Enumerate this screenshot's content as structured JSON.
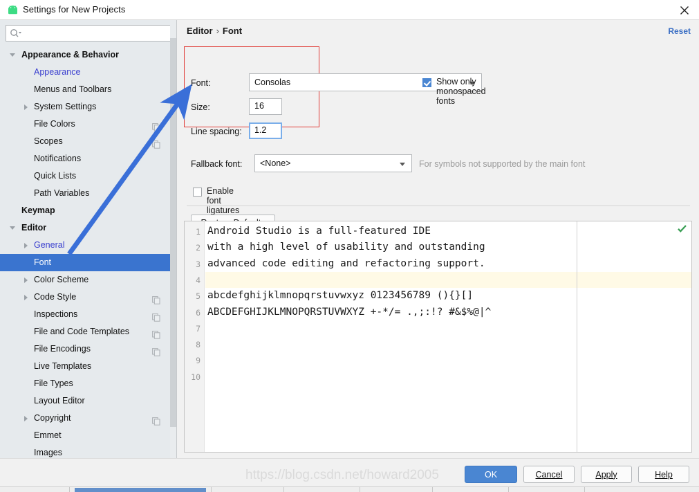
{
  "window": {
    "title": "Settings for New Projects",
    "app_icon": "android-icon",
    "close_icon": "close-icon"
  },
  "sidebar": {
    "search": {
      "placeholder": "",
      "value": "",
      "icon": "search-icon"
    },
    "items": [
      {
        "label": "Appearance & Behavior",
        "level": 0,
        "twisty": "down",
        "selected": false,
        "link": false,
        "copy": false
      },
      {
        "label": "Appearance",
        "level": 1,
        "twisty": "none",
        "selected": false,
        "link": true,
        "copy": false
      },
      {
        "label": "Menus and Toolbars",
        "level": 1,
        "twisty": "none",
        "selected": false,
        "link": false,
        "copy": false
      },
      {
        "label": "System Settings",
        "level": 1,
        "twisty": "right",
        "selected": false,
        "link": false,
        "copy": false
      },
      {
        "label": "File Colors",
        "level": 1,
        "twisty": "none",
        "selected": false,
        "link": false,
        "copy": true
      },
      {
        "label": "Scopes",
        "level": 1,
        "twisty": "none",
        "selected": false,
        "link": false,
        "copy": true
      },
      {
        "label": "Notifications",
        "level": 1,
        "twisty": "none",
        "selected": false,
        "link": false,
        "copy": false
      },
      {
        "label": "Quick Lists",
        "level": 1,
        "twisty": "none",
        "selected": false,
        "link": false,
        "copy": false
      },
      {
        "label": "Path Variables",
        "level": 1,
        "twisty": "none",
        "selected": false,
        "link": false,
        "copy": false
      },
      {
        "label": "Keymap",
        "level": 0,
        "twisty": "none",
        "selected": false,
        "link": false,
        "copy": false
      },
      {
        "label": "Editor",
        "level": 0,
        "twisty": "down",
        "selected": false,
        "link": false,
        "copy": false
      },
      {
        "label": "General",
        "level": 1,
        "twisty": "right",
        "selected": false,
        "link": true,
        "copy": false
      },
      {
        "label": "Font",
        "level": 1,
        "twisty": "none",
        "selected": true,
        "link": false,
        "copy": false
      },
      {
        "label": "Color Scheme",
        "level": 1,
        "twisty": "right",
        "selected": false,
        "link": false,
        "copy": false
      },
      {
        "label": "Code Style",
        "level": 1,
        "twisty": "right",
        "selected": false,
        "link": false,
        "copy": true
      },
      {
        "label": "Inspections",
        "level": 1,
        "twisty": "none",
        "selected": false,
        "link": false,
        "copy": true
      },
      {
        "label": "File and Code Templates",
        "level": 1,
        "twisty": "none",
        "selected": false,
        "link": false,
        "copy": true
      },
      {
        "label": "File Encodings",
        "level": 1,
        "twisty": "none",
        "selected": false,
        "link": false,
        "copy": true
      },
      {
        "label": "Live Templates",
        "level": 1,
        "twisty": "none",
        "selected": false,
        "link": false,
        "copy": false
      },
      {
        "label": "File Types",
        "level": 1,
        "twisty": "none",
        "selected": false,
        "link": false,
        "copy": false
      },
      {
        "label": "Layout Editor",
        "level": 1,
        "twisty": "none",
        "selected": false,
        "link": false,
        "copy": false
      },
      {
        "label": "Copyright",
        "level": 1,
        "twisty": "right",
        "selected": false,
        "link": false,
        "copy": true
      },
      {
        "label": "Emmet",
        "level": 1,
        "twisty": "none",
        "selected": false,
        "link": false,
        "copy": false
      },
      {
        "label": "Images",
        "level": 1,
        "twisty": "none",
        "selected": false,
        "link": false,
        "copy": false
      }
    ]
  },
  "main": {
    "breadcrumb": {
      "root": "Editor",
      "separator": "›",
      "leaf": "Font"
    },
    "reset_label": "Reset",
    "font_row": {
      "label": "Font:",
      "value": "Consolas"
    },
    "size_row": {
      "label": "Size:",
      "value": "16"
    },
    "spacing_row": {
      "label": "Line spacing:",
      "value": "1.2"
    },
    "monospaced_checkbox": {
      "label": "Show only monospaced fonts",
      "checked": true
    },
    "fallback_row": {
      "label": "Fallback font:",
      "value": "<None>",
      "hint": "For symbols not supported by the main font"
    },
    "ligatures_checkbox": {
      "label": "Enable font ligatures",
      "checked": false
    },
    "restore_defaults_label": "Restore Defaults"
  },
  "preview": {
    "lines": [
      {
        "no": "1",
        "text": "Android Studio is a full-featured IDE",
        "caret": false
      },
      {
        "no": "2",
        "text": "with a high level of usability and outstanding",
        "caret": false
      },
      {
        "no": "3",
        "text": "advanced code editing and refactoring support.",
        "caret": false
      },
      {
        "no": "4",
        "text": "",
        "caret": true
      },
      {
        "no": "5",
        "text": "abcdefghijklmnopqrstuvwxyz 0123456789 (){}[]",
        "caret": false
      },
      {
        "no": "6",
        "text": "ABCDEFGHIJKLMNOPQRSTUVWXYZ +-*/= .,;:!? #&$%@|^",
        "caret": false
      },
      {
        "no": "7",
        "text": "",
        "caret": false
      },
      {
        "no": "8",
        "text": "",
        "caret": false
      },
      {
        "no": "9",
        "text": "",
        "caret": false
      },
      {
        "no": "10",
        "text": "",
        "caret": false
      }
    ],
    "inspection_status_icon": "green-check-icon"
  },
  "footer": {
    "ok": "OK",
    "cancel": "Cancel",
    "apply": "Apply",
    "help": "Help"
  },
  "watermark": {
    "text": "https://blog.csdn.net/howard2005"
  },
  "colors": {
    "selection_blue": "#3a74cf",
    "primary_button": "#4a86d2",
    "link_blue": "#3b40cf",
    "reset_blue": "#3b6fc4",
    "annotation_red": "#e03b36",
    "annotation_arrow_blue": "#3a6fd8",
    "caret_line": "#fffae6",
    "sidebar_bg": "#e6eaed",
    "panel_bg": "#f1f1f1"
  }
}
